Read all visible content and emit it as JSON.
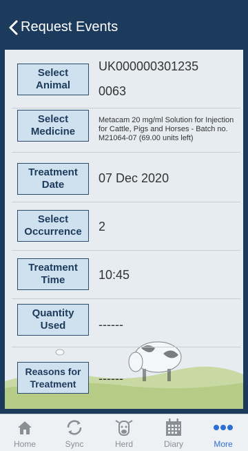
{
  "header": {
    "title": "Request Events"
  },
  "rows": [
    {
      "button": "Select\nAnimal",
      "value": "UK000000301235",
      "value2": "0063"
    },
    {
      "button": "Select\nMedicine",
      "value": "Metacam 20 mg/ml Solution for Injection for Cattle, Pigs and Horses - Batch no. M21064-07 (69.00 units left)"
    },
    {
      "button": "Treatment\nDate",
      "value": "07 Dec 2020"
    },
    {
      "button": "Select\nOccurrence",
      "value": "2"
    },
    {
      "button": "Treatment\nTime",
      "value": "10:45"
    },
    {
      "button": "Quantity\nUsed",
      "value": "------"
    },
    {
      "button": "Reasons for\nTreatment",
      "value": "------"
    }
  ],
  "tabs": [
    {
      "label": "Home",
      "icon": "home-icon"
    },
    {
      "label": "Sync",
      "icon": "sync-icon"
    },
    {
      "label": "Herd",
      "icon": "cow-icon"
    },
    {
      "label": "Diary",
      "icon": "calendar-icon"
    },
    {
      "label": "More",
      "icon": "more-icon",
      "active": true
    }
  ],
  "colors": {
    "header": "#1c3a5c",
    "button_bg": "#cfe0ef",
    "active_tab": "#2e6fd6"
  }
}
